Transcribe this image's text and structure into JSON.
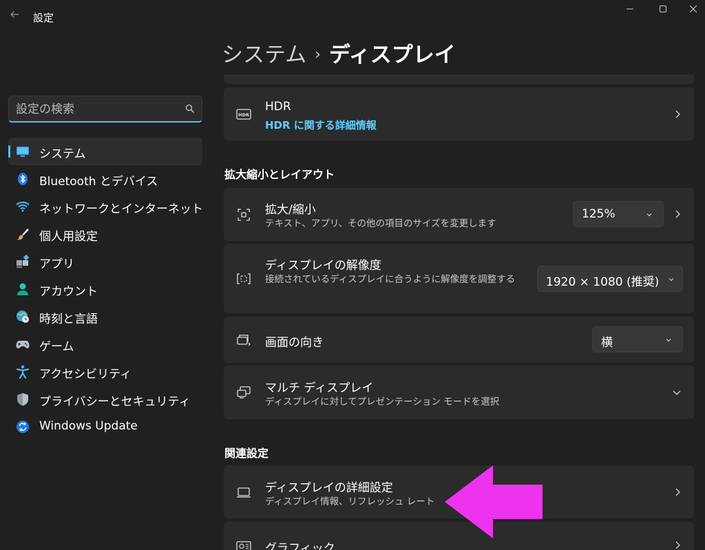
{
  "window": {
    "app_title": "設定"
  },
  "sidebar": {
    "search_placeholder": "設定の検索",
    "items": [
      {
        "label": "システム",
        "icon": "monitor-icon",
        "selected": true
      },
      {
        "label": "Bluetooth とデバイス",
        "icon": "bluetooth-icon"
      },
      {
        "label": "ネットワークとインターネット",
        "icon": "wifi-icon"
      },
      {
        "label": "個人用設定",
        "icon": "brush-icon"
      },
      {
        "label": "アプリ",
        "icon": "apps-icon"
      },
      {
        "label": "アカウント",
        "icon": "account-icon"
      },
      {
        "label": "時刻と言語",
        "icon": "globe-clock-icon"
      },
      {
        "label": "ゲーム",
        "icon": "gamepad-icon"
      },
      {
        "label": "アクセシビリティ",
        "icon": "accessibility-icon"
      },
      {
        "label": "プライバシーとセキュリティ",
        "icon": "shield-icon"
      },
      {
        "label": "Windows Update",
        "icon": "update-icon"
      }
    ]
  },
  "breadcrumb": {
    "parent": "システム",
    "separator": "›",
    "current": "ディスプレイ"
  },
  "hdr": {
    "title": "HDR",
    "link": "HDR に関する詳細情報"
  },
  "scale_layout": {
    "section_title": "拡大縮小とレイアウト",
    "scale": {
      "title": "拡大/縮小",
      "subtitle": "テキスト、アプリ、その他の項目のサイズを変更します",
      "value": "125%"
    },
    "resolution": {
      "title": "ディスプレイの解像度",
      "subtitle": "接続されているディスプレイに合うように解像度を調整する",
      "value": "1920 × 1080 (推奨)"
    },
    "orientation": {
      "title": "画面の向き",
      "value": "横"
    },
    "multi_display": {
      "title": "マルチ ディスプレイ",
      "subtitle": "ディスプレイに対してプレゼンテーション モードを選択"
    }
  },
  "related": {
    "section_title": "関連設定",
    "advanced_display": {
      "title": "ディスプレイの詳細設定",
      "subtitle": "ディスプレイ情報、リフレッシュ レート"
    },
    "graphics": {
      "title": "グラフィック"
    }
  },
  "colors": {
    "accent": "#4cc2ff",
    "link": "#60cdff",
    "annotation_arrow": "#ee33ee"
  }
}
